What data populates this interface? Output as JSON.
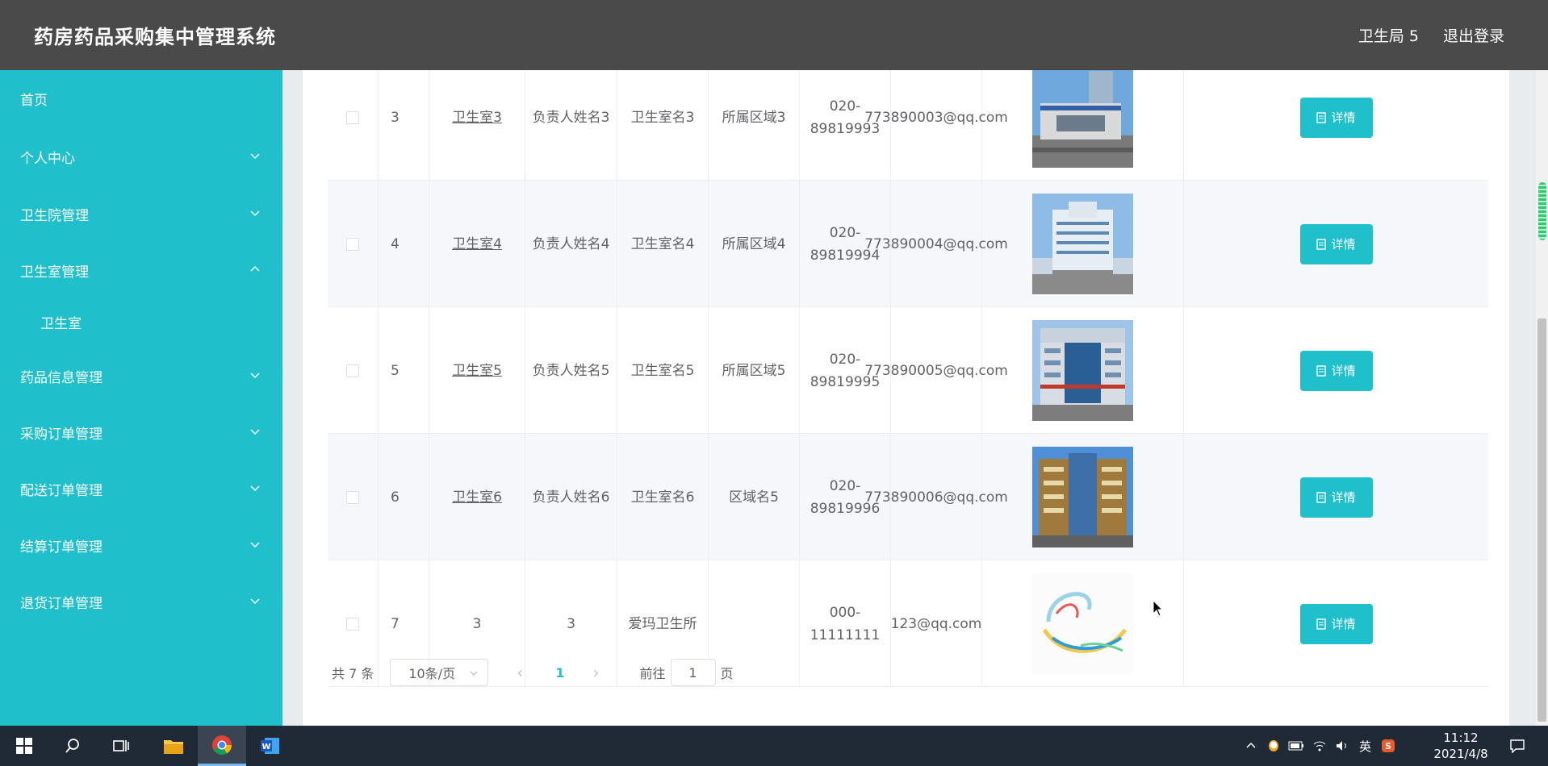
{
  "app": {
    "title": "药房药品采购集中管理系统",
    "user": "卫生局 5",
    "logout": "退出登录"
  },
  "sidebar": {
    "items": [
      {
        "label": "首页"
      },
      {
        "label": "个人中心"
      },
      {
        "label": "卫生院管理"
      },
      {
        "label": "卫生室管理"
      },
      {
        "label": "卫生室"
      },
      {
        "label": "药品信息管理"
      },
      {
        "label": "采购订单管理"
      },
      {
        "label": "配送订单管理"
      },
      {
        "label": "结算订单管理"
      },
      {
        "label": "退货订单管理"
      }
    ]
  },
  "table": {
    "rows": [
      {
        "index": "3",
        "code": "卫生室3",
        "manager": "负责人姓名3",
        "name": "卫生室名3",
        "region": "所属区域3",
        "phone": "020-89819993",
        "email": "773890003@qq.com",
        "image": "hospital-building-photo",
        "action": "详情"
      },
      {
        "index": "4",
        "code": "卫生室4",
        "manager": "负责人姓名4",
        "name": "卫生室名4",
        "region": "所属区域4",
        "phone": "020-89819994",
        "email": "773890004@qq.com",
        "image": "hospital-building-photo",
        "action": "详情"
      },
      {
        "index": "5",
        "code": "卫生室5",
        "manager": "负责人姓名5",
        "name": "卫生室名5",
        "region": "所属区域5",
        "phone": "020-89819995",
        "email": "773890005@qq.com",
        "image": "hospital-building-photo",
        "action": "详情"
      },
      {
        "index": "6",
        "code": "卫生室6",
        "manager": "负责人姓名6",
        "name": "卫生室名6",
        "region": "区域名5",
        "phone": "020-89819996",
        "email": "773890006@qq.com",
        "image": "hospital-building-photo",
        "action": "详情"
      },
      {
        "index": "7",
        "code": "3",
        "manager": "3",
        "name": "爱玛卫生所",
        "region": "",
        "phone": "000-11111111",
        "email": "123@qq.com",
        "image": "abstract-swirl-image",
        "action": "详情"
      }
    ]
  },
  "pagination": {
    "total": "共 7 条",
    "page_size": "10条/页",
    "current": "1",
    "goto_prefix": "前往",
    "goto_value": "1",
    "goto_suffix": "页"
  },
  "taskbar": {
    "ime": "英",
    "time": "11:12",
    "date": "2021/4/8"
  },
  "colors": {
    "accent": "#1fbfcb",
    "topbar": "#4a4a4a"
  }
}
